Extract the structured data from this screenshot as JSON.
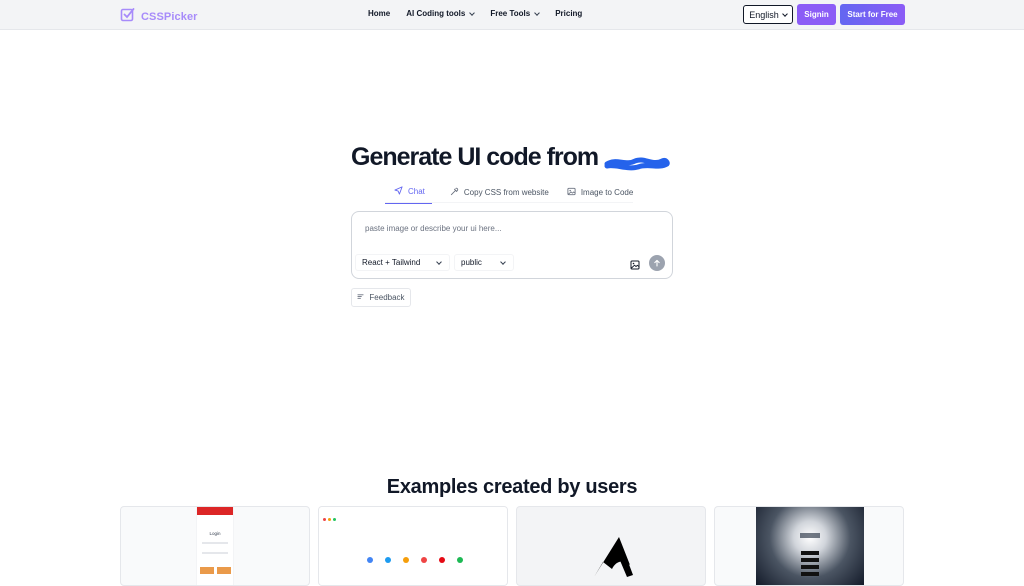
{
  "header": {
    "logo_text": "CSSPicker",
    "nav": [
      {
        "label": "Home"
      },
      {
        "label": "AI Coding tools"
      },
      {
        "label": "Free Tools"
      },
      {
        "label": "Pricing"
      }
    ],
    "language": "English",
    "signin_label": "Signin",
    "start_label": "Start for Free"
  },
  "hero": {
    "title": "Generate UI code from",
    "tabs": [
      {
        "label": "Chat",
        "icon": "send-icon"
      },
      {
        "label": "Copy CSS from website",
        "icon": "eyedropper-icon"
      },
      {
        "label": "Image to Code",
        "icon": "image-icon"
      }
    ],
    "prompt_placeholder": "paste image or describe your ui here...",
    "framework": "React + Tailwind",
    "visibility": "public",
    "feedback_label": "Feedback"
  },
  "examples": {
    "title": "Examples created by users",
    "cards": [
      {
        "login_title": "Login"
      },
      {},
      {},
      {}
    ]
  },
  "colors": {
    "accent": "#8b5cf6",
    "accent_indigo": "#6366f1",
    "scribble": "#2563eb"
  }
}
